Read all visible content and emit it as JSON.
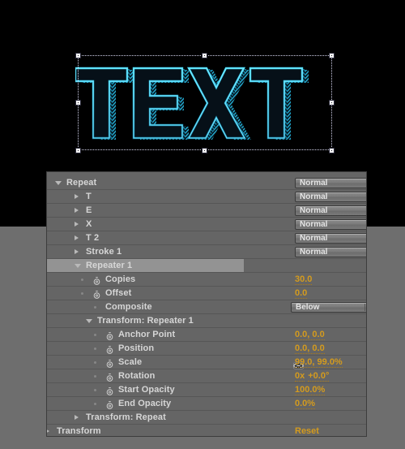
{
  "app": {
    "artwork_text": "TEXT",
    "artwork_colors": {
      "stroke": "#2bc4e8",
      "fill_dark": "#0a1c24",
      "background": "#000000"
    },
    "selection": {
      "handle_count": 8,
      "bounds_style": "dotted"
    }
  },
  "panel": {
    "colors": {
      "row_bg": "#656565",
      "row_selected_bg": "#939393",
      "label": "#d6d6d6",
      "value_orange": "#d49b1e",
      "divider": "#565656"
    },
    "rows": [
      {
        "label": "Repeat",
        "indent": 24,
        "twirl": "open",
        "marker": "none",
        "control": "dropdown-normal",
        "value": "",
        "selected": false
      },
      {
        "label": "T",
        "indent": 48,
        "twirl": "closed",
        "marker": "none",
        "control": "dropdown-normal",
        "value": "",
        "selected": false
      },
      {
        "label": "E",
        "indent": 48,
        "twirl": "closed",
        "marker": "none",
        "control": "dropdown-normal",
        "value": "",
        "selected": false
      },
      {
        "label": "X",
        "indent": 48,
        "twirl": "closed",
        "marker": "none",
        "control": "dropdown-normal",
        "value": "",
        "selected": false
      },
      {
        "label": "T 2",
        "indent": 48,
        "twirl": "closed",
        "marker": "none",
        "control": "dropdown-normal",
        "value": "",
        "selected": false
      },
      {
        "label": "Stroke 1",
        "indent": 48,
        "twirl": "closed",
        "marker": "none",
        "control": "dropdown-normal",
        "value": "",
        "selected": false
      },
      {
        "label": "Repeater 1",
        "indent": 48,
        "twirl": "open",
        "marker": "none",
        "control": "none",
        "value": "",
        "selected": true
      },
      {
        "label": "Copies",
        "indent": 72,
        "twirl": "none",
        "marker": "stopwatch",
        "control": "none",
        "value": "30.0",
        "selected": false
      },
      {
        "label": "Offset",
        "indent": 72,
        "twirl": "none",
        "marker": "stopwatch",
        "control": "none",
        "value": "0.0",
        "selected": false
      },
      {
        "label": "Composite",
        "indent": 72,
        "twirl": "none",
        "marker": "dot",
        "control": "dropdown-below",
        "value": "",
        "selected": false
      },
      {
        "label": "Transform: Repeater 1",
        "indent": 62,
        "twirl": "open",
        "marker": "none",
        "control": "none",
        "value": "",
        "selected": false
      },
      {
        "label": "Anchor Point",
        "indent": 88,
        "twirl": "none",
        "marker": "stopwatch",
        "control": "none",
        "value": "0.0, 0.0",
        "selected": false
      },
      {
        "label": "Position",
        "indent": 88,
        "twirl": "none",
        "marker": "stopwatch",
        "control": "none",
        "value": "0.0, 0.0",
        "selected": false
      },
      {
        "label": "Scale",
        "indent": 88,
        "twirl": "none",
        "marker": "stopwatch",
        "control": "link",
        "value": "99.0, 99.0%",
        "selected": false
      },
      {
        "label": "Rotation",
        "indent": 88,
        "twirl": "none",
        "marker": "stopwatch",
        "control": "none",
        "value": "0x +0.0°",
        "selected": false
      },
      {
        "label": "Start Opacity",
        "indent": 88,
        "twirl": "none",
        "marker": "stopwatch",
        "control": "none",
        "value": "100.0%",
        "selected": false
      },
      {
        "label": "End Opacity",
        "indent": 88,
        "twirl": "none",
        "marker": "stopwatch",
        "control": "none",
        "value": "0.0%",
        "selected": false
      },
      {
        "label": "Transform: Repeat",
        "indent": 48,
        "twirl": "closed",
        "marker": "none",
        "control": "none",
        "value": "",
        "selected": false
      },
      {
        "label": "Transform",
        "indent": 12,
        "twirl": "closed",
        "marker": "none",
        "control": "none",
        "value": "Reset",
        "selected": false
      }
    ],
    "dropdowns": {
      "blend_mode_value": "Normal",
      "composite_value": "Below"
    },
    "icons": {
      "stopwatch": "stopwatch-icon",
      "link": "link-chain-icon",
      "twirl_open": "triangle-down-icon",
      "twirl_closed": "triangle-right-icon",
      "dropdown_arrow": "chevron-down-icon"
    }
  }
}
